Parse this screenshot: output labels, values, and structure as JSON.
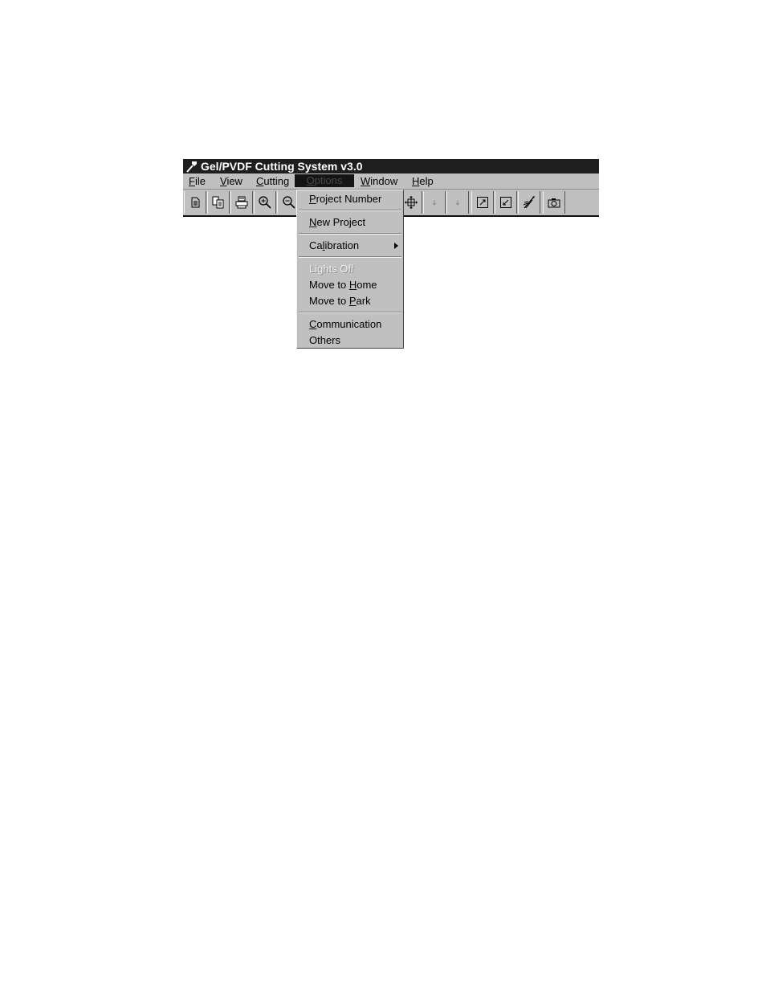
{
  "window": {
    "title": "Gel/PVDF Cutting System v3.0"
  },
  "menubar": {
    "file": {
      "pre": "",
      "u": "F",
      "post": "ile"
    },
    "view": {
      "pre": "",
      "u": "V",
      "post": "iew"
    },
    "cutting": {
      "pre": "",
      "u": "C",
      "post": "utting"
    },
    "options": {
      "pre": "",
      "u": "O",
      "post": "ptions"
    },
    "window": {
      "pre": "",
      "u": "W",
      "post": "indow"
    },
    "help": {
      "pre": "",
      "u": "H",
      "post": "elp"
    }
  },
  "toolbar": {
    "icons": [
      "new-document-icon",
      "copy-icon",
      "print-icon",
      "zoom-in-icon",
      "zoom-out-icon",
      "move-icon",
      "arrow-down-icon",
      "arrow-down-icon",
      "expand-icon",
      "shrink-icon",
      "cut-tool-icon",
      "camera-icon"
    ]
  },
  "options_menu": {
    "project_number": {
      "pre": "",
      "u": "P",
      "post": "roject Number"
    },
    "new_project": {
      "pre": "",
      "u": "N",
      "post": "ew Project"
    },
    "calibration": {
      "pre": "Ca",
      "u": "l",
      "post": "ibration"
    },
    "lights_off": "Lights Off",
    "move_home": {
      "pre": "Move to ",
      "u": "H",
      "post": "ome"
    },
    "move_park": {
      "pre": "Move to ",
      "u": "P",
      "post": "ark"
    },
    "communication": {
      "pre": "",
      "u": "C",
      "post": "ommunication"
    },
    "others": "Others"
  }
}
